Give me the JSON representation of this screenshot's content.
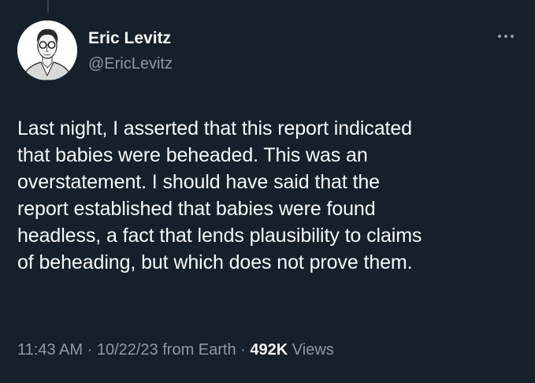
{
  "author": {
    "display_name": "Eric Levitz",
    "handle": "@EricLevitz"
  },
  "icons": {
    "avatar": "portrait-sketch-avatar",
    "more": "more-horizontal-icon"
  },
  "tweet": {
    "text": "Last night, I asserted that this report indicated\nthat babies were beheaded. This was an\noverstatement. I should have said that the\nreport established that babies were found\nheadless, a fact that lends plausibility to claims\nof beheading, but which does not prove them."
  },
  "meta": {
    "time": "11:43 AM",
    "separator": "·",
    "date": "10/22/23",
    "source": "from Earth",
    "views_count": "492K",
    "views_label": "Views"
  },
  "colors": {
    "background": "#15202b",
    "primary_text": "#f7f9f9",
    "secondary_text": "#8b98a5"
  }
}
